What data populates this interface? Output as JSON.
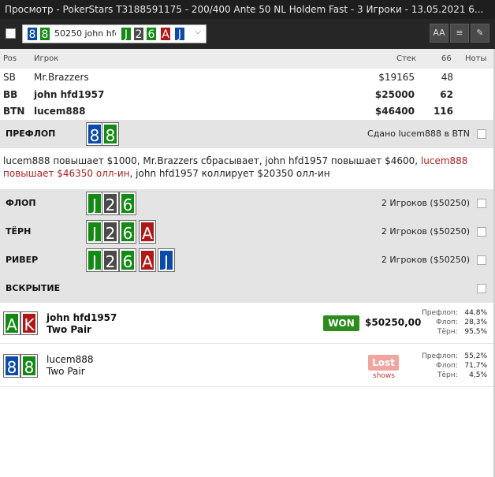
{
  "window": {
    "title": "Просмотр - PokerStars T3188591175 - 200/400 Ante 50 NL Holdem Fast - 3 Игроки - 13.05.2021 6..."
  },
  "toolbar": {
    "selected_hand_text": "50250 john hfd",
    "hole_cards": [
      "8",
      "8"
    ],
    "board_cards": [
      "J",
      "2",
      "6",
      "A",
      "J"
    ],
    "font_button": "AA",
    "list_button": "≡",
    "edit_button": "✎"
  },
  "table_header": {
    "pos": "Pos",
    "player": "Игрок",
    "stack": "Стек",
    "bb": "66",
    "notes": "Ноты"
  },
  "players": [
    {
      "pos": "SB",
      "name": "Mr.Brazzers",
      "stack": "$19165",
      "bb": "48",
      "bold": false
    },
    {
      "pos": "BB",
      "name": "john hfd1957",
      "stack": "$25000",
      "bb": "62",
      "bold": true
    },
    {
      "pos": "BTN",
      "name": "lucem888",
      "stack": "$46400",
      "bb": "116",
      "bold": true
    }
  ],
  "preflop": {
    "label": "ПРЕФЛОП",
    "cards": [
      "8",
      "8"
    ],
    "dealt_text": "Сдано lucem888 в BTN",
    "actions_normal": "lucem888 повышает $1000, Mr.Brazzers сбрасывает, john hfd1957 повышает $4600, ",
    "actions_highlight": "lucem888 повышает $46350 олл-ин",
    "actions_tail": ", john hfd1957 коллирует $20350 олл-ин"
  },
  "streets": [
    {
      "label": "ФЛОП",
      "cards": [
        "J",
        "2",
        "6"
      ],
      "info": "2 Игроков ($50250)"
    },
    {
      "label": "ТЁРН",
      "cards": [
        "J",
        "2",
        "6",
        "A"
      ],
      "info": "2 Игроков ($50250)"
    },
    {
      "label": "РИВЕР",
      "cards": [
        "J",
        "2",
        "6",
        "A",
        "J"
      ],
      "info": "2 Игроков ($50250)"
    },
    {
      "label": "ВСКРЫТИЕ",
      "cards": [],
      "info": ""
    }
  ],
  "results": [
    {
      "cards": [
        "A",
        "K"
      ],
      "name": "john hfd1957",
      "hand": "Two Pair",
      "status": "WON",
      "amount": "$50250,00",
      "equity": [
        {
          "label": "Префлоп:",
          "value": "44,8%"
        },
        {
          "label": "Флоп:",
          "value": "28,3%"
        },
        {
          "label": "Тёрн:",
          "value": "95,5%"
        }
      ]
    },
    {
      "cards": [
        "8",
        "8"
      ],
      "name": "lucem888",
      "hand": "Two Pair",
      "status": "Lost",
      "status_sub": "shows",
      "equity": [
        {
          "label": "Префлоп:",
          "value": "55,2%"
        },
        {
          "label": "Флоп:",
          "value": "71,7%"
        },
        {
          "label": "Тёрн:",
          "value": "4,5%"
        }
      ]
    }
  ],
  "colors": {
    "spade": "#4a4a4a",
    "heart": "#b01818",
    "diamond": "#0a4aa8",
    "club": "#138a13",
    "won": "#2e8b1e",
    "lost": "#f0a6a0",
    "raise_text": "#a8231f"
  }
}
